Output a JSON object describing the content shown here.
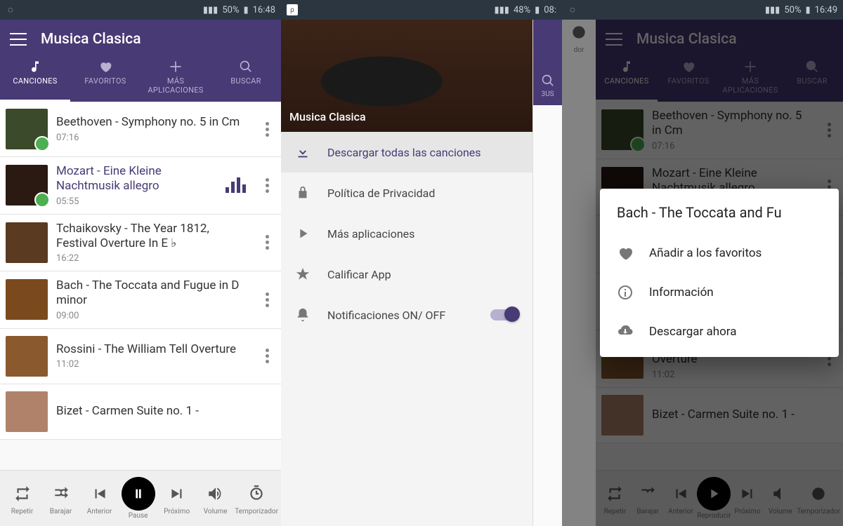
{
  "status": {
    "battery": "50%",
    "time1": "16:48",
    "time2": "08:",
    "battery2": "48%",
    "time3": "16:49"
  },
  "app": {
    "title": "Musica Clasica"
  },
  "tabs": {
    "songs": "CANCIONES",
    "fav": "FAVORITOS",
    "more": "MÁS",
    "apps": "APLICACIONES",
    "search": "BUSCAR"
  },
  "songs": [
    {
      "title": "Beethoven - Symphony no. 5 in Cm",
      "dur": "07:16"
    },
    {
      "title": "Mozart - Eine Kleine Nachtmusik allegro",
      "dur": "05:55"
    },
    {
      "title": "Tchaikovsky - The Year 1812, Festival Overture In E ♭",
      "dur": "16:22"
    },
    {
      "title": "Bach - The Toccata and Fugue in D minor",
      "dur": "09:00"
    },
    {
      "title": "Rossini - The William Tell Overture",
      "dur": "11:02"
    },
    {
      "title": "Bizet - Carmen Suite no. 1 -",
      "dur": ""
    }
  ],
  "player": {
    "repeat": "Repetir",
    "shuffle": "Barajar",
    "prev": "Anterior",
    "pause": "Pause",
    "play": "Reproducir",
    "next": "Próximo",
    "vol": "Volume",
    "timer": "Temporizador"
  },
  "drawer": {
    "title": "Musica Clasica",
    "download": "Descargar todas las canciones",
    "privacy": "Política de Privacidad",
    "moreapps": "Más aplicaciones",
    "rate": "Calificar App",
    "notif": "Notificaciones ON/ OFF"
  },
  "dialog": {
    "title": "Bach - The Toccata and Fu",
    "fav": "Añadir a los favoritos",
    "info": "Información",
    "download": "Descargar ahora"
  }
}
